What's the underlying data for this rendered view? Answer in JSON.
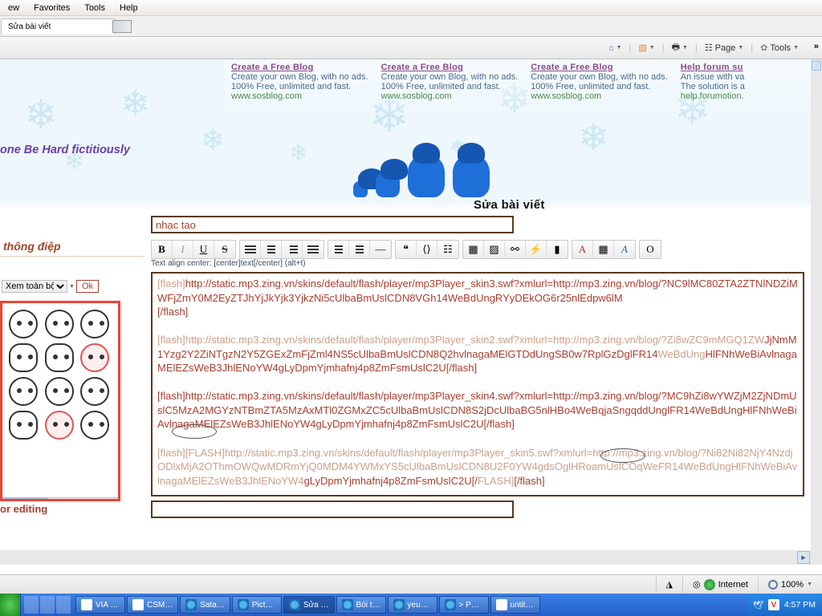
{
  "menubar": [
    "ew",
    "Favorites",
    "Tools",
    "Help"
  ],
  "tab_title": "Sửa bài viết",
  "cmdbar": {
    "page": "Page",
    "tools": "Tools"
  },
  "ads": [
    {
      "head": "Create a Free Blog",
      "l1": "Create your own Blog, with no ads.",
      "l2": "100% Free, unlimited and fast.",
      "link": "www.sosblog.com"
    },
    {
      "head": "Create a Free Blog",
      "l1": "Create your own Blog, with no ads.",
      "l2": "100% Free, unlimited and fast.",
      "link": "www.sosblog.com"
    },
    {
      "head": "Create a Free Blog",
      "l1": "Create your own Blog, with no ads.",
      "l2": "100% Free, unlimited and fast.",
      "link": "www.sosblog.com"
    },
    {
      "head": "Help forum su",
      "l1": "An issue with va",
      "l2": "The solution is a",
      "link": "help.forumotion."
    }
  ],
  "banner": "one Be Hard fictitiously",
  "edit_title": "Sửa bài viết",
  "title_value": "nhạc tao",
  "sidebar": {
    "head": "thông điệp",
    "select": "Xem toàn bộ",
    "ok": "Ok",
    "for_editing": "or editing"
  },
  "toolbar_hint": "Text align center: [center]text[/center] (alt+t)",
  "textarea": {
    "p1a": "[flash]",
    "p1b": "http://static.mp3.zing.vn/skins/default/flash/player/mp3Player_skin3.swf?xmlurl=http://mp3.zing.vn/blog/?NC9lMC80ZTA2ZTNlNDZiMWFjZmY0M2EyZTJhYjJkYjk3YjkzNi5cUlbaBmUslCDN8VGh14WeBdUngRYyDEkOG6r25nlEdpw6lM",
    "p1c": "[/flash]",
    "p2a": "[flash]http://static.mp3.zing.vn/skins/default/flash/player/mp3Player_skin2.swf?xmlurl=http://mp3.zing.vn/blog/?Zi8wZC9mMGQ1ZW",
    "p2b": "JjNmM1Yzg2Y2ZiNTgzN2Y5ZGExZmFjZml4NS5cUlbaBmUslCDN8Q2hvlnagaMElGTDdUngSB0w7RplGzDglFR14",
    "p2c": "WeBdUng",
    "p2d": "HlFNhWeBiAvlnagaMElEZsWeB3JhlENoYW4gLyDpmYjmhafnj4p8ZmFsmUslC2U[/flash]",
    "p3": "[flash]http://static.mp3.zing.vn/skins/default/flash/player/mp3Player_skin4.swf?xmlurl=http://mp3.zing.vn/blog/?MC9hZi8wYWZjM2ZjNDmUslC5MzA2MGYzNTBmZTA5MzAxMTl0ZGMxZC5cUlbaBmUslCDN8S2jDcUlbaBG5nlHBo4WeBqjaSngqddUnglFR14WeBdUngHlFNhWeBiAvlnagaMElEZsWeB3JhlENoYW4gLyDpmYjmhafnj4p8ZmFsmUslC2U[/flash]",
    "p4a": "[flash]",
    "p4b": "[FLASH]",
    "p4c": "http://static.mp3.zing.vn/skins/default/flash/player/mp3Player_skin5.swf?xmlurl=http://mp3.zing.vn/blog/?Ni82Ni82NjY4NzdjODlxMjA2OThmOWQwMDRmYjQ0MDM4YWMxYS5cUlbaBmUslCDN8U2F0YW4gdsOglHRoamUslCOqWeFR14WeBdUngHlFNhWeBiAvlnag",
    "p4d": "aMElEZsWeB3JhlENoYW4",
    "p4e": "gLyDpmYjmhafnj4p8ZmFsmUslC2U[/",
    "p4f": "FLASH]",
    "p4g": "[/flash]"
  },
  "status": {
    "zone": "Internet",
    "zoom": "100%"
  },
  "tasks": [
    {
      "label": "VIA …",
      "icon": "app"
    },
    {
      "label": "CSM…",
      "icon": "app"
    },
    {
      "label": "Sata…",
      "icon": "ie"
    },
    {
      "label": "Pict…",
      "icon": "ie"
    },
    {
      "label": "Sửa …",
      "icon": "ie",
      "active": true
    },
    {
      "label": "Bói t…",
      "icon": "ie"
    },
    {
      "label": "yeu…",
      "icon": "ie"
    },
    {
      "label": "> P…",
      "icon": "ie"
    },
    {
      "label": "untit…",
      "icon": "app"
    }
  ],
  "clock": "4:57 PM"
}
